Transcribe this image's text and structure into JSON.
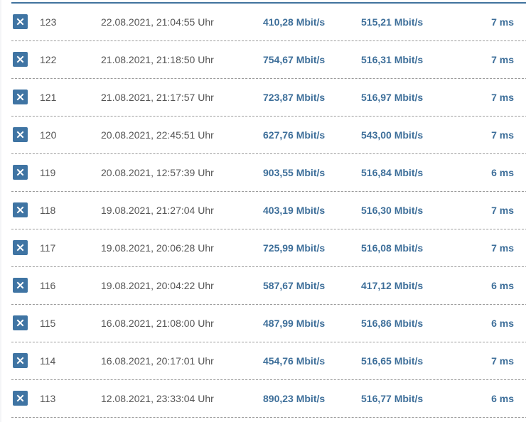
{
  "colors": {
    "accent": "#3f74a3",
    "value_text": "#3e6f9a",
    "plain_text": "#555555",
    "divider": "#9a9a9a"
  },
  "delete_icon": "close-icon",
  "rows": [
    {
      "id": "123",
      "date": "22.08.2021, 21:04:55 Uhr",
      "download": "410,28 Mbit/s",
      "upload": "515,21 Mbit/s",
      "ping": "7 ms"
    },
    {
      "id": "122",
      "date": "21.08.2021, 21:18:50 Uhr",
      "download": "754,67 Mbit/s",
      "upload": "516,31 Mbit/s",
      "ping": "7 ms"
    },
    {
      "id": "121",
      "date": "21.08.2021, 21:17:57 Uhr",
      "download": "723,87 Mbit/s",
      "upload": "516,97 Mbit/s",
      "ping": "7 ms"
    },
    {
      "id": "120",
      "date": "20.08.2021, 22:45:51 Uhr",
      "download": "627,76 Mbit/s",
      "upload": "543,00 Mbit/s",
      "ping": "7 ms"
    },
    {
      "id": "119",
      "date": "20.08.2021, 12:57:39 Uhr",
      "download": "903,55 Mbit/s",
      "upload": "516,84 Mbit/s",
      "ping": "6 ms"
    },
    {
      "id": "118",
      "date": "19.08.2021, 21:27:04 Uhr",
      "download": "403,19 Mbit/s",
      "upload": "516,30 Mbit/s",
      "ping": "7 ms"
    },
    {
      "id": "117",
      "date": "19.08.2021, 20:06:28 Uhr",
      "download": "725,99 Mbit/s",
      "upload": "516,08 Mbit/s",
      "ping": "7 ms"
    },
    {
      "id": "116",
      "date": "19.08.2021, 20:04:22 Uhr",
      "download": "587,67 Mbit/s",
      "upload": "417,12 Mbit/s",
      "ping": "6 ms"
    },
    {
      "id": "115",
      "date": "16.08.2021, 21:08:00 Uhr",
      "download": "487,99 Mbit/s",
      "upload": "516,86 Mbit/s",
      "ping": "6 ms"
    },
    {
      "id": "114",
      "date": "16.08.2021, 20:17:01 Uhr",
      "download": "454,76 Mbit/s",
      "upload": "516,65 Mbit/s",
      "ping": "7 ms"
    },
    {
      "id": "113",
      "date": "12.08.2021, 23:33:04 Uhr",
      "download": "890,23 Mbit/s",
      "upload": "516,77 Mbit/s",
      "ping": "6 ms"
    }
  ]
}
